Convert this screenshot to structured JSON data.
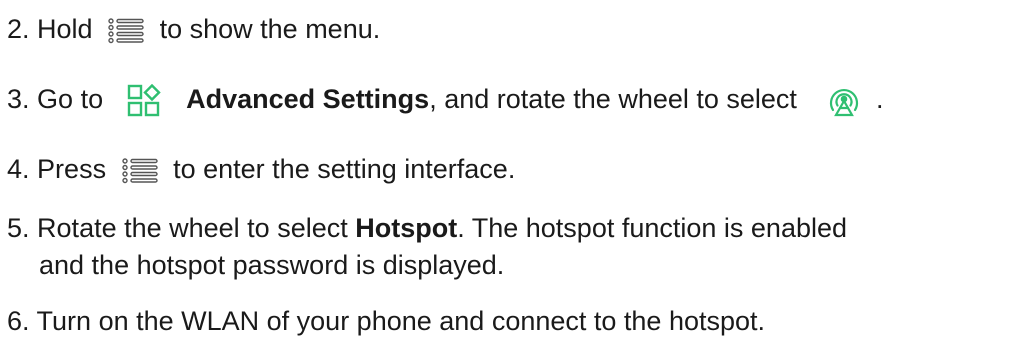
{
  "icons": {
    "menu_icon": "menu-list-icon",
    "advanced_settings_icon": "advanced-settings-icon",
    "hotspot_icon": "hotspot-icon"
  },
  "colors": {
    "text": "#1a1a1a",
    "accent_green": "#2fbf71",
    "icon_gray": "#555555"
  },
  "steps": [
    {
      "number": "2.",
      "before": "Hold",
      "after": "to show the menu."
    },
    {
      "number": "3.",
      "before": "Go to",
      "bold": "Advanced Settings",
      "after": ", and rotate the wheel to select",
      "end": "."
    },
    {
      "number": "4.",
      "before": "Press",
      "after": "to enter the setting interface."
    },
    {
      "number": "5.",
      "before": "Rotate the wheel to select",
      "bold": "Hotspot",
      "after": ". The hotspot function is enabled",
      "continuation": "and the hotspot password is displayed."
    },
    {
      "number": "6.",
      "text": "Turn on the WLAN of your phone and connect to the hotspot."
    }
  ]
}
